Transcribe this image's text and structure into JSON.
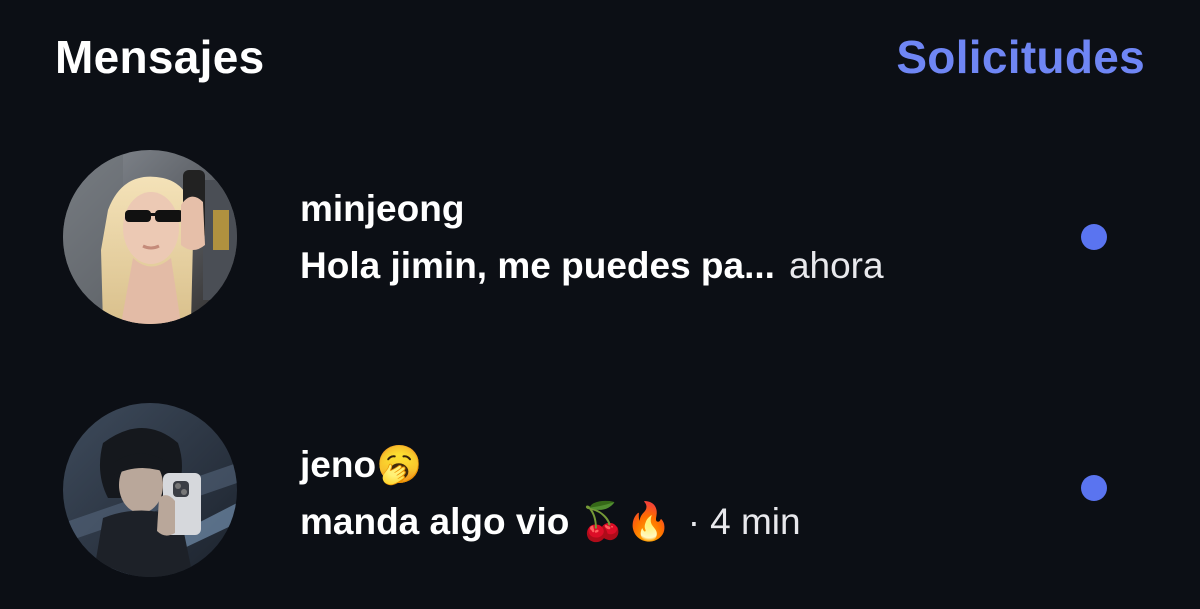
{
  "header": {
    "title": "Mensajes",
    "requests_label": "Solicitudes"
  },
  "threads": [
    {
      "username": "minjeong",
      "preview": "Hola jimin, me puedes pa...",
      "time": "ahora",
      "unread": true,
      "avatar": "profile-photo"
    },
    {
      "username": "jeno",
      "username_emoji": "🥱",
      "preview": "manda algo vio ",
      "preview_emoji": "🍒🔥",
      "separator": "·",
      "time": "4 min",
      "unread": true,
      "avatar": "profile-photo"
    }
  ],
  "colors": {
    "background": "#0c0f15",
    "accent": "#6f86f4",
    "unread_dot": "#5a74f0",
    "text": "#ffffff"
  }
}
